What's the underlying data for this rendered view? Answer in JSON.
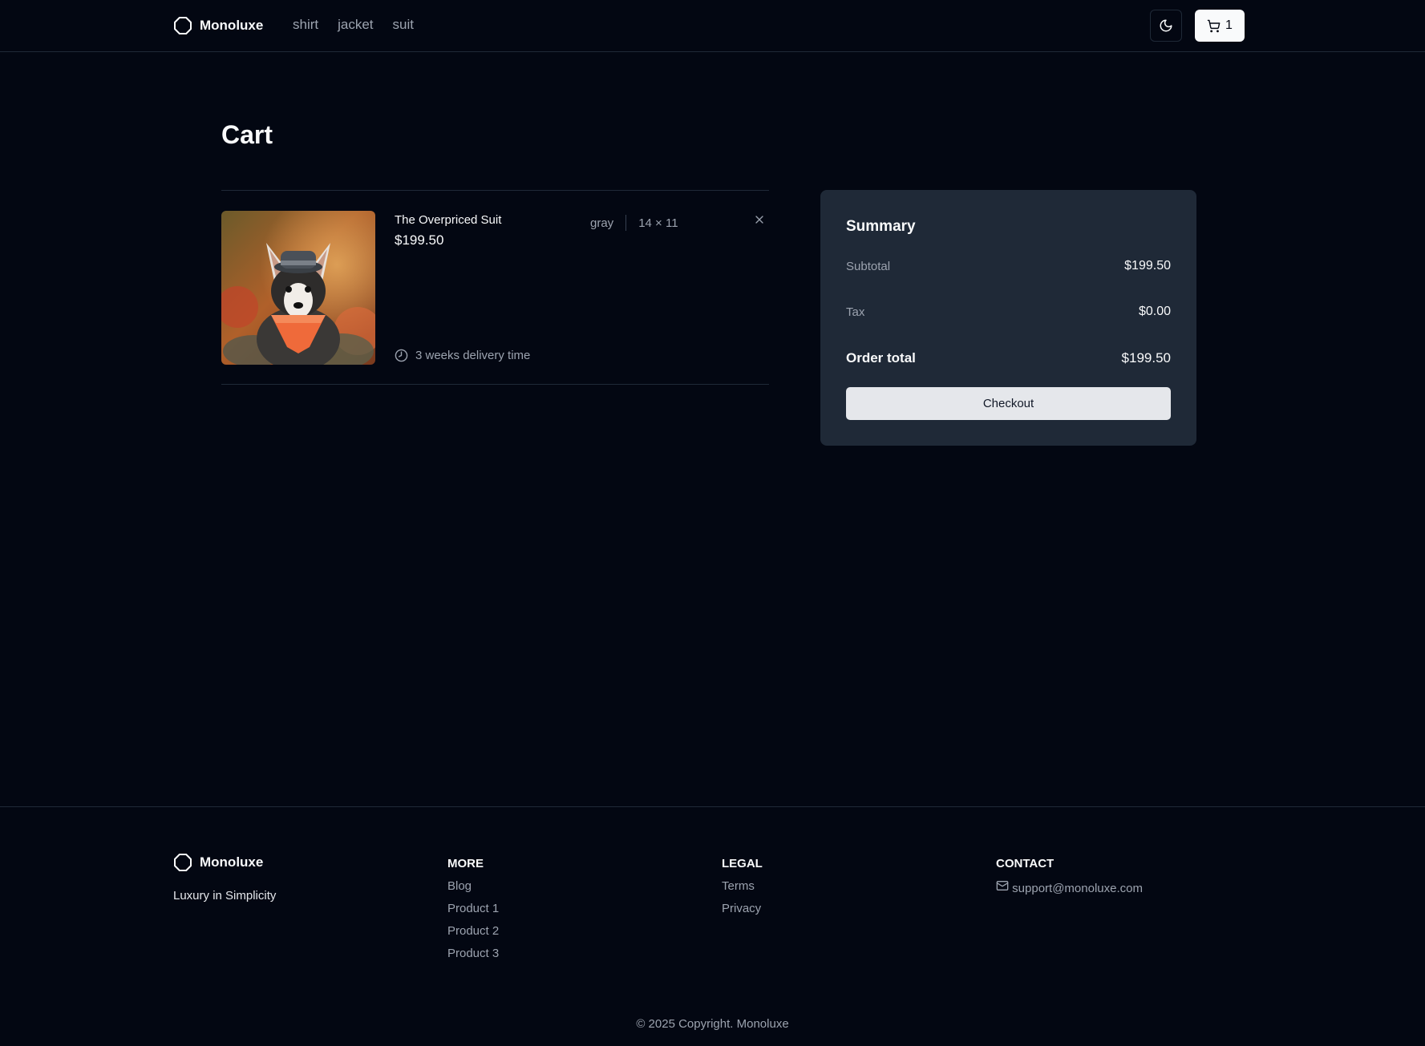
{
  "header": {
    "brand": "Monoluxe",
    "nav": [
      "shirt",
      "jacket",
      "suit"
    ],
    "cart_count": "1"
  },
  "cart": {
    "title": "Cart",
    "items": [
      {
        "name": "The Overpriced Suit",
        "price": "$199.50",
        "color": "gray",
        "size": "14 × 11",
        "delivery": "3 weeks delivery time"
      }
    ]
  },
  "summary": {
    "title": "Summary",
    "subtotal_label": "Subtotal",
    "subtotal": "$199.50",
    "tax_label": "Tax",
    "tax": "$0.00",
    "total_label": "Order total",
    "total": "$199.50",
    "checkout_label": "Checkout"
  },
  "footer": {
    "brand": "Monoluxe",
    "tagline": "Luxury in Simplicity",
    "more": {
      "title": "MORE",
      "links": [
        "Blog",
        "Product 1",
        "Product 2",
        "Product 3"
      ]
    },
    "legal": {
      "title": "LEGAL",
      "links": [
        "Terms",
        "Privacy"
      ]
    },
    "contact": {
      "title": "CONTACT",
      "email": "support@monoluxe.com"
    },
    "copyright": "© 2025 Copyright. Monoluxe"
  },
  "icons": {
    "logo": "octagon-icon",
    "theme": "moon-icon",
    "cart": "cart-icon",
    "remove": "close-icon",
    "delivery": "clock-icon",
    "email": "mail-icon"
  }
}
